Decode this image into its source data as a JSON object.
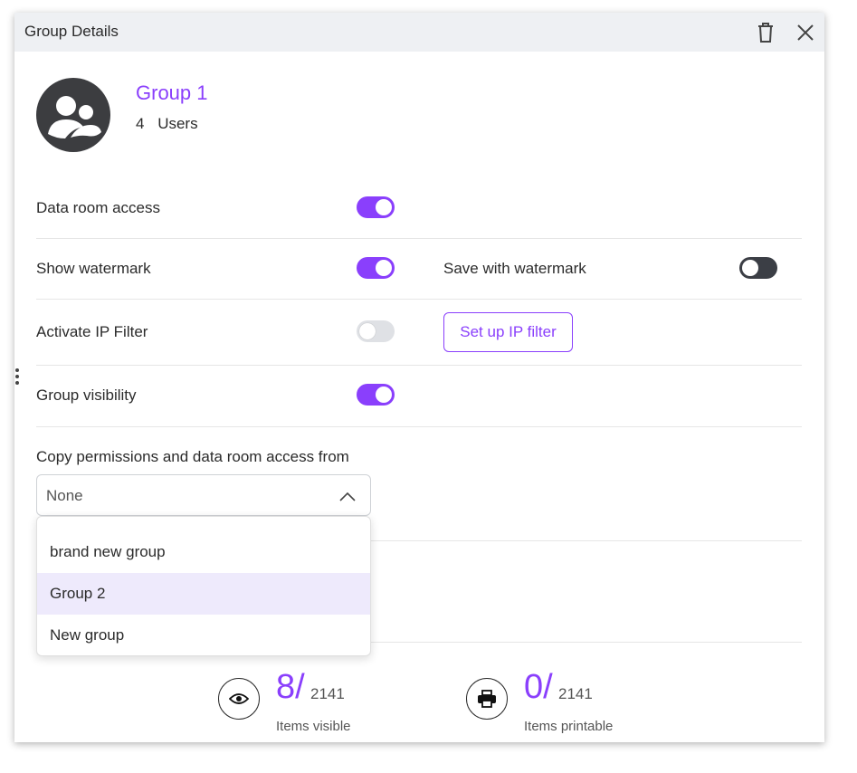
{
  "header": {
    "title": "Group Details",
    "trash_icon": "trash-icon",
    "close_icon": "close-icon"
  },
  "group": {
    "avatar_icon": "group-avatar-icon",
    "name": "Group 1",
    "user_count": "4",
    "user_label": "Users"
  },
  "settings": {
    "data_room_access": {
      "label": "Data room access",
      "on": true
    },
    "show_watermark": {
      "label": "Show watermark",
      "on": true
    },
    "save_with_watermark": {
      "label": "Save with watermark",
      "on": false
    },
    "activate_ip_filter": {
      "label": "Activate IP Filter",
      "on": false
    },
    "setup_ip_button": "Set up IP filter",
    "group_visibility": {
      "label": "Group visibility",
      "on": true
    }
  },
  "copy": {
    "label": "Copy permissions and data room access from",
    "selected": "None",
    "options": [
      "brand new group",
      "Group 2",
      "New group"
    ],
    "highlighted": "Group 2"
  },
  "stats": {
    "visible": {
      "value": "8",
      "total": "2141",
      "caption": "Items visible",
      "icon": "eye-icon"
    },
    "printable": {
      "value": "0",
      "total": "2141",
      "caption": "Items printable",
      "icon": "printer-icon"
    }
  },
  "colors": {
    "accent": "#8a3ffc",
    "header_bg": "#eef0f3",
    "highlight_bg": "#eeeafc"
  }
}
